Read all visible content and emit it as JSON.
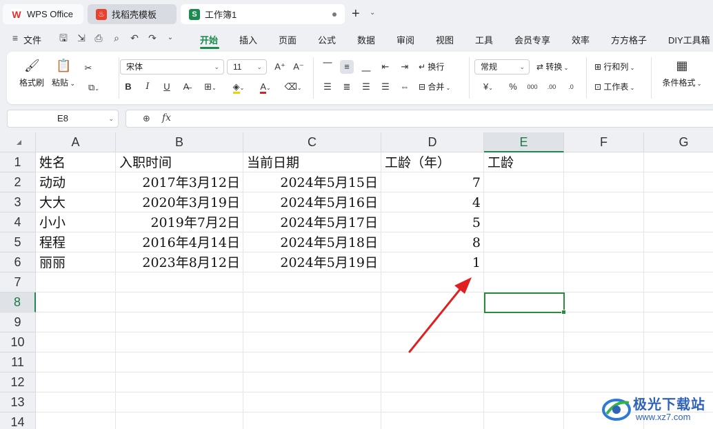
{
  "tabs": {
    "wps": {
      "label": "WPS Office",
      "icon": "wps-logo-icon"
    },
    "template": {
      "label": "找稻壳模板",
      "icon": "docer-icon"
    },
    "workbook": {
      "label": "工作簿1",
      "icon_letter": "S"
    }
  },
  "menu": {
    "file": "文件",
    "items": [
      "开始",
      "插入",
      "页面",
      "公式",
      "数据",
      "审阅",
      "视图",
      "工具",
      "会员专享",
      "效率",
      "方方格子",
      "DIY工具箱"
    ],
    "active": "开始"
  },
  "ribbon": {
    "format_painter": "格式刷",
    "paste": "粘贴",
    "font_name": "宋体",
    "font_size": "11",
    "wrap_text": "换行",
    "merge": "合并",
    "number_format": "常规",
    "convert": "转换",
    "row_col": "行和列",
    "worksheet": "工作表",
    "cond_format": "条件格式",
    "currency_symbol": "¥",
    "percent_symbol": "%"
  },
  "formula_bar": {
    "name_box": "E8",
    "fx_label": "fx",
    "content": ""
  },
  "sheet": {
    "columns": [
      "A",
      "B",
      "C",
      "D",
      "E",
      "F",
      "G"
    ],
    "rows": [
      "1",
      "2",
      "3",
      "4",
      "5",
      "6",
      "7",
      "8",
      "9",
      "10",
      "11",
      "12",
      "13",
      "14"
    ],
    "selected_col": "E",
    "selected_row": "8",
    "cells": [
      [
        "姓名",
        "入职时间",
        "当前日期",
        "工龄（年）",
        "工龄"
      ],
      [
        "动动",
        "2017年3月12日",
        "2024年5月15日",
        "7",
        ""
      ],
      [
        "大大",
        "2020年3月19日",
        "2024年5月16日",
        "4",
        ""
      ],
      [
        "小小",
        "2019年7月2日",
        "2024年5月17日",
        "5",
        ""
      ],
      [
        "程程",
        "2016年4月14日",
        "2024年5月18日",
        "8",
        ""
      ],
      [
        "丽丽",
        "2023年8月12日",
        "2024年5月19日",
        "1",
        ""
      ]
    ]
  },
  "annotation_color": "#e02020",
  "accent_color": "#1a8a4e",
  "watermark": {
    "title": "极光下载站",
    "url": "www.xz7.com"
  }
}
